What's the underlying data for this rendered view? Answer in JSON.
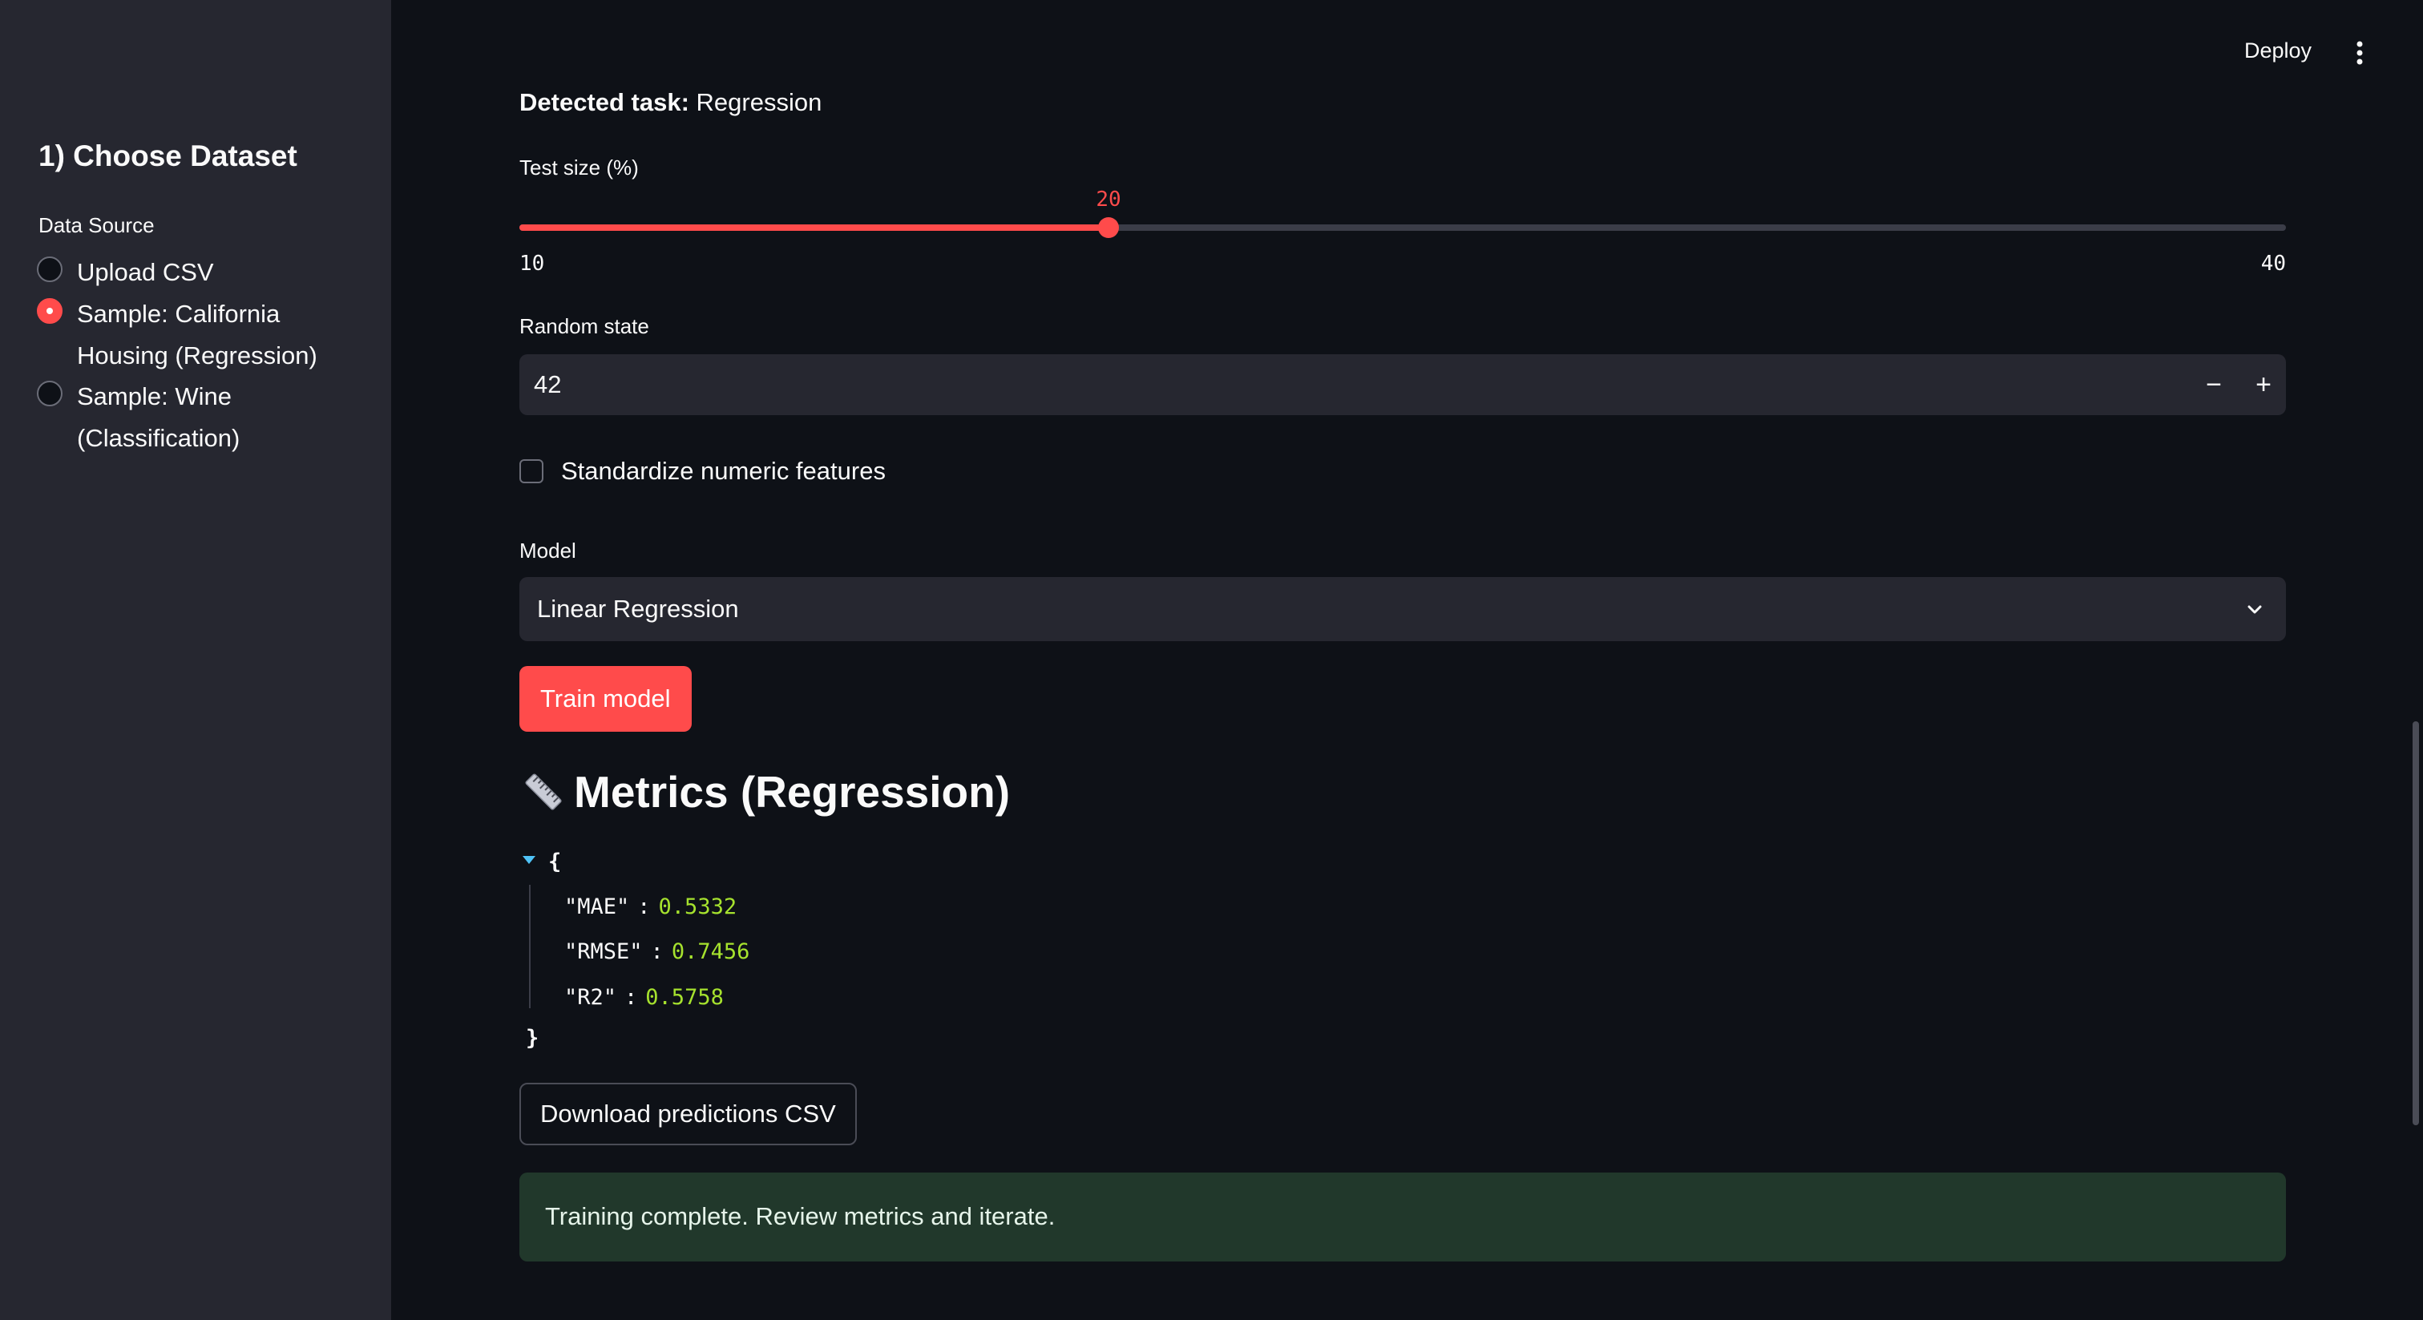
{
  "sidebar": {
    "title": "1) Choose Dataset",
    "data_source_label": "Data Source",
    "options": [
      {
        "line1": "Upload CSV",
        "line2": "",
        "checked": false
      },
      {
        "line1": "Sample: California",
        "line2": "Housing (Regression)",
        "checked": true
      },
      {
        "line1": "Sample: Wine",
        "line2": "(Classification)",
        "checked": false
      }
    ]
  },
  "header": {
    "deploy_label": "Deploy",
    "menu_icon": "more-vertical-icon"
  },
  "main": {
    "detected_task_label": "Detected task:",
    "detected_task_value": "Regression",
    "test_size": {
      "label": "Test size (%)",
      "value": "20",
      "min": "10",
      "max": "40"
    },
    "random_state": {
      "label": "Random state",
      "value": "42",
      "minus": "−",
      "plus": "+"
    },
    "standardize": {
      "label": "Standardize numeric features",
      "checked": false
    },
    "model": {
      "label": "Model",
      "selected": "Linear Regression"
    },
    "train_button": "Train model",
    "metrics": {
      "heading": "Metrics (Regression)",
      "icon": "ruler-icon",
      "open_brace": "{",
      "close_brace": "}",
      "rows": [
        {
          "key": "\"MAE\"",
          "value": "0.5332"
        },
        {
          "key": "\"RMSE\"",
          "value": "0.7456"
        },
        {
          "key": "\"R2\"",
          "value": "0.5758"
        }
      ]
    },
    "download_button": "Download predictions CSV",
    "success_message": "Training complete. Review metrics and iterate."
  },
  "colors": {
    "accent": "#ff4b4b",
    "background": "#0e1117",
    "sidebar": "#262730",
    "success_bg": "#21382b",
    "json_number": "#a6e22e"
  }
}
